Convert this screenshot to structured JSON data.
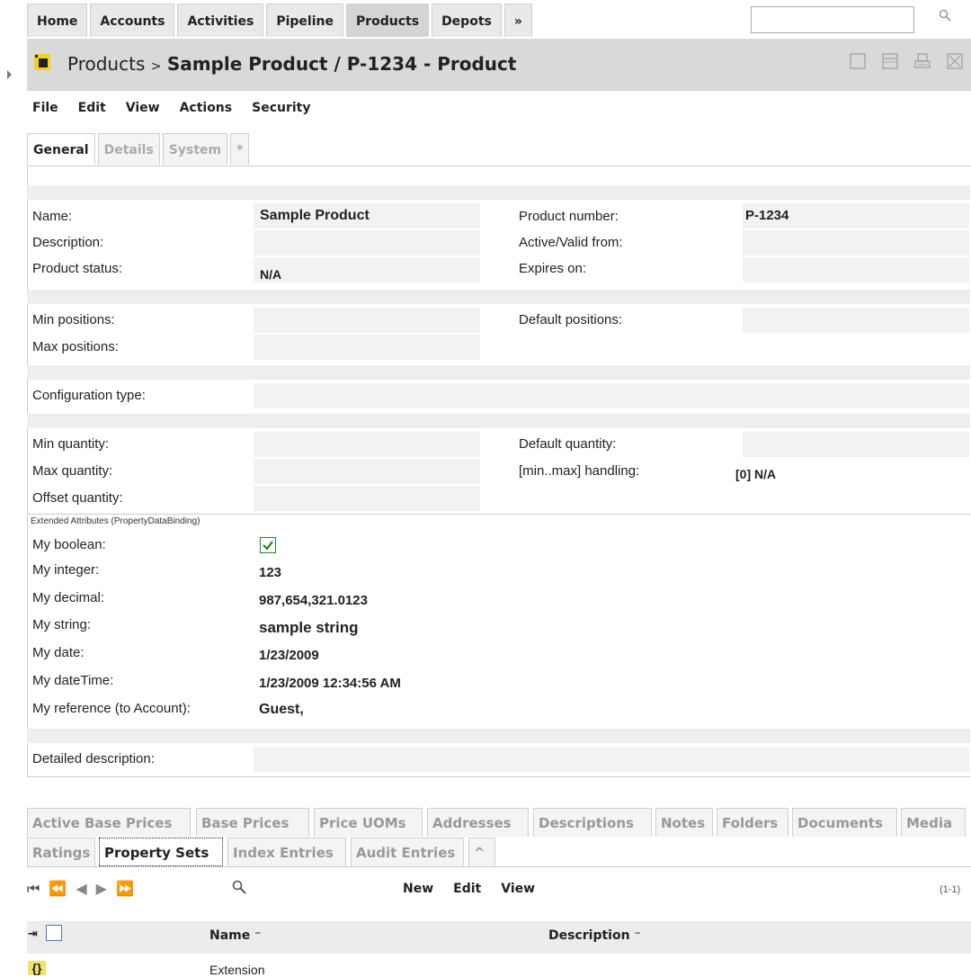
{
  "nav": {
    "tabs": [
      "Home",
      "Accounts",
      "Activities",
      "Pipeline",
      "Products",
      "Depots",
      "»"
    ],
    "active": "Products"
  },
  "header": {
    "breadcrumb": "Products",
    "separator": ">",
    "title": "Sample Product / P-1234 - Product"
  },
  "menu": [
    "File",
    "Edit",
    "View",
    "Actions",
    "Security"
  ],
  "subtabs": [
    "General",
    "Details",
    "System",
    "*"
  ],
  "form": {
    "name_label": "Name:",
    "name_value": "Sample Product",
    "product_number_label": "Product number:",
    "product_number_value": "P-1234",
    "description_label": "Description:",
    "active_from_label": "Active/Valid from:",
    "product_status_label": "Product status:",
    "product_status_value": "N/A",
    "expires_label": "Expires on:",
    "min_positions_label": "Min positions:",
    "default_positions_label": "Default positions:",
    "max_positions_label": "Max positions:",
    "configuration_type_label": "Configuration type:",
    "min_quantity_label": "Min quantity:",
    "default_quantity_label": "Default quantity:",
    "max_quantity_label": "Max quantity:",
    "minmax_label": "[min..max] handling:",
    "minmax_value": "[0] N/A",
    "offset_quantity_label": "Offset quantity:",
    "extended_label": "Extended Attributes (PropertyDataBinding)",
    "my_boolean_label": "My boolean:",
    "my_integer_label": "My integer:",
    "my_integer_value": "123",
    "my_decimal_label": "My decimal:",
    "my_decimal_value": "987,654,321.0123",
    "my_string_label": "My string:",
    "my_string_value": "sample string",
    "my_date_label": "My date:",
    "my_date_value": "1/23/2009",
    "my_datetime_label": "My dateTime:",
    "my_datetime_value": "1/23/2009 12:34:56 AM",
    "my_reference_label": "My reference (to Account):",
    "my_reference_value": "Guest,",
    "detailed_description_label": "Detailed description:"
  },
  "bottom_tabs_row1": [
    "Active Base Prices",
    "Base Prices",
    "Price UOMs",
    "Addresses",
    "Descriptions",
    "Notes",
    "Folders",
    "Documents",
    "Media"
  ],
  "bottom_tabs_row2": [
    "Ratings",
    "Property Sets",
    "Index Entries",
    "Audit Entries",
    "^"
  ],
  "grid": {
    "menu": [
      "New",
      "Edit",
      "View"
    ],
    "range": "(1-1)",
    "col_name": "Name",
    "col_description": "Description",
    "rows": [
      {
        "name": "Extension"
      }
    ]
  },
  "colors": {
    "bar": "#d9d9d9",
    "check": "#2a7d2a",
    "highlight": "#f1e06a"
  }
}
